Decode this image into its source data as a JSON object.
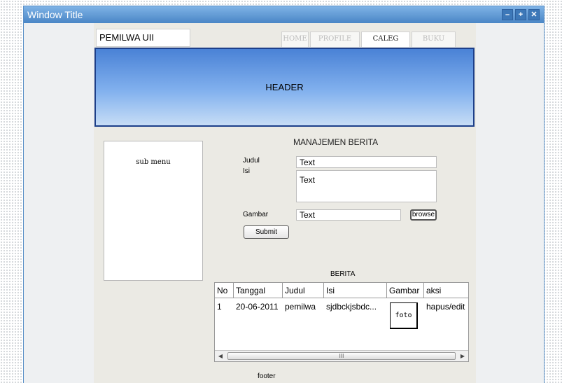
{
  "window": {
    "title": "Window Title",
    "controls": {
      "minimize": "–",
      "maximize": "+",
      "close": "✕"
    }
  },
  "site": {
    "logo": "PEMILWA UII",
    "nav": [
      {
        "label": "HOME",
        "active": false
      },
      {
        "label": "PROFILE",
        "active": false
      },
      {
        "label": "CALEG",
        "active": true
      },
      {
        "label": "BUKU TAMU",
        "active": false
      }
    ],
    "header": "HEADER"
  },
  "submenu": {
    "label": "sub menu"
  },
  "form": {
    "title": "MANAJEMEN BERITA",
    "judul": {
      "label": "Judul",
      "value": "Text"
    },
    "isi": {
      "label": "Isi",
      "value": "Text"
    },
    "gambar": {
      "label": "Gambar",
      "value": "Text"
    },
    "browse_label": "browse",
    "submit_label": "Submit"
  },
  "table": {
    "title": "BERITA",
    "columns": [
      "No",
      "Tanggal",
      "Judul",
      "Isi",
      "Gambar",
      "aksi"
    ],
    "rows": [
      {
        "no": "1",
        "tanggal": "20-06-2011",
        "judul": "pemilwa",
        "isi": "sjdbckjsbdc...",
        "gambar": "foto",
        "aksi": "hapus/edit"
      }
    ],
    "scrollbar": {
      "left_arrow": "◀",
      "right_arrow": "▶",
      "grip": "III"
    }
  },
  "footer": "footer",
  "colors": {
    "titlebar": "#5b95d4",
    "header_top": "#4a82d6",
    "header_border": "#1d3f8a",
    "page_bg": "#ebeae4"
  },
  "icons": [
    "minimize-icon",
    "maximize-icon",
    "close-icon",
    "scroll-left-icon",
    "scroll-right-icon"
  ]
}
